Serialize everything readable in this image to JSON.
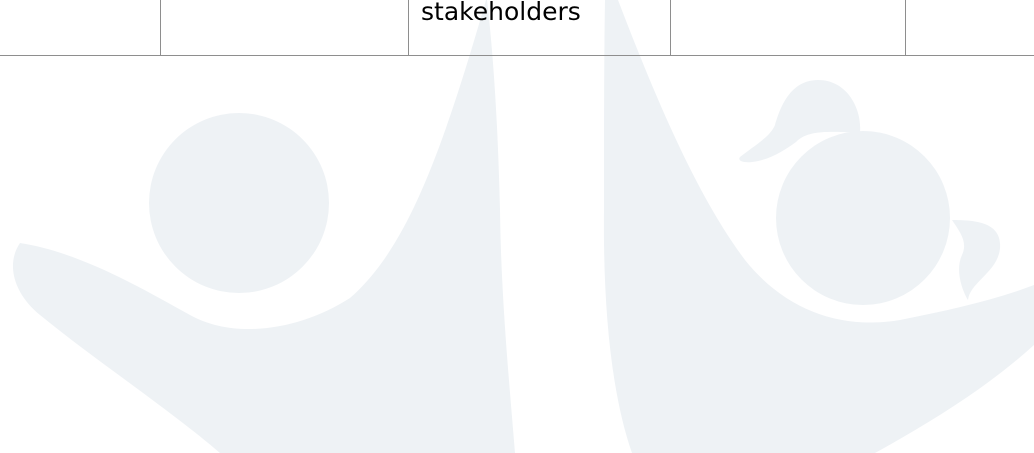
{
  "table": {
    "visible_cell_text": "stakeholders"
  },
  "colors": {
    "watermark": "#eef2f5",
    "table_border": "#8e8e8e",
    "text": "#000000",
    "background": "#ffffff"
  },
  "watermark": {
    "icon": "two-children-raising-arms-icon"
  }
}
